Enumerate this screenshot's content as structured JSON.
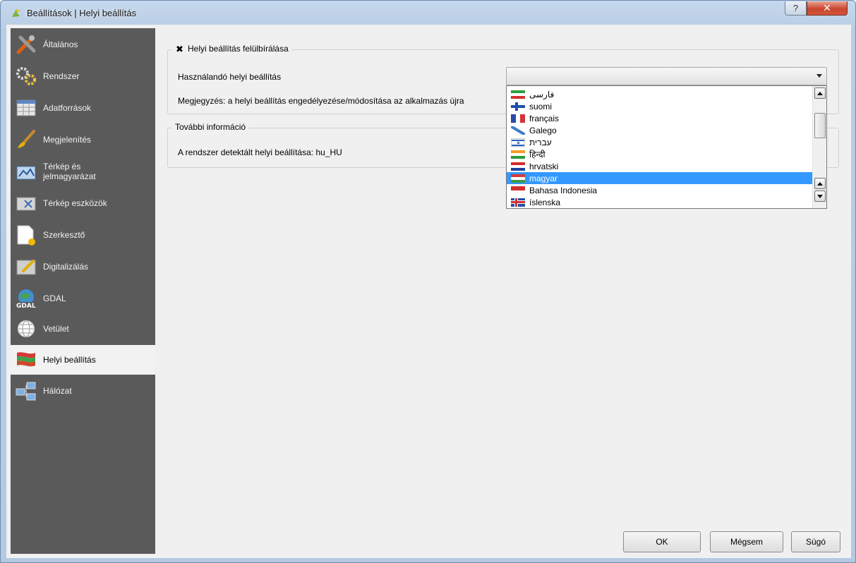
{
  "window": {
    "title": "Beállítások | Helyi beállítás",
    "help_glyph": "?",
    "close_glyph": "✕"
  },
  "sidebar": {
    "items": [
      {
        "label": "Általános",
        "icon": "tools-icon"
      },
      {
        "label": "Rendszer",
        "icon": "gears-icon"
      },
      {
        "label": "Adatforrások",
        "icon": "table-icon"
      },
      {
        "label": "Megjelenítés",
        "icon": "brush-icon"
      },
      {
        "label": "Térkép és\njelmagyarázat",
        "icon": "map-legend-icon"
      },
      {
        "label": "Térkép eszközök",
        "icon": "map-tools-icon"
      },
      {
        "label": "Szerkesztő",
        "icon": "editor-icon"
      },
      {
        "label": "Digitalizálás",
        "icon": "digitize-icon"
      },
      {
        "label": "GDAL",
        "icon": "gdal-icon"
      },
      {
        "label": "Vetület",
        "icon": "globe-icon"
      },
      {
        "label": "Helyi beállítás",
        "icon": "locale-flag-icon",
        "selected": true
      },
      {
        "label": "Hálózat",
        "icon": "network-icon"
      }
    ]
  },
  "override_group": {
    "checkbox_glyph": "✖",
    "title": "Helyi beállítás felülbírálása",
    "locale_label": "Használandó helyi beállítás",
    "note": "Megjegyzés: a helyi beállítás engedélyezése/módosítása az alkalmazás újra"
  },
  "info_group": {
    "title": "További információ",
    "detected": "A rendszer detektált helyi beállítása: hu_HU"
  },
  "dropdown": {
    "items": [
      {
        "label": "فارسی",
        "flag": "iran"
      },
      {
        "label": "suomi",
        "flag": "finland"
      },
      {
        "label": "français",
        "flag": "france"
      },
      {
        "label": "Galego",
        "flag": "galicia"
      },
      {
        "label": "עברית",
        "flag": "israel"
      },
      {
        "label": "हिन्दी",
        "flag": "india"
      },
      {
        "label": "hrvatski",
        "flag": "croatia"
      },
      {
        "label": "magyar",
        "flag": "hungary",
        "selected": true
      },
      {
        "label": "Bahasa Indonesia",
        "flag": "indonesia"
      },
      {
        "label": "íslenska",
        "flag": "iceland"
      }
    ]
  },
  "buttons": {
    "ok": "OK",
    "cancel": "Mégsem",
    "help": "Súgó"
  },
  "colors": {
    "sidebar_bg": "#5a5a5a",
    "selection": "#3399ff",
    "dialog_bg": "#f0f0f0"
  }
}
